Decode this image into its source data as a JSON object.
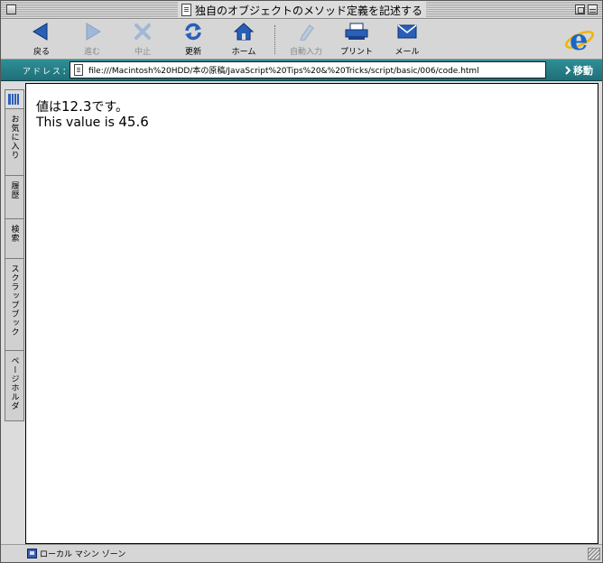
{
  "window": {
    "title": "独自のオブジェクトのメソッド定義を記述する"
  },
  "toolbar": {
    "back_label": "戻る",
    "forward_label": "進む",
    "stop_label": "中止",
    "refresh_label": "更新",
    "home_label": "ホーム",
    "autofill_label": "自動入力",
    "print_label": "プリント",
    "mail_label": "メール"
  },
  "address": {
    "label": "アドレス：",
    "url": "file:///Macintosh%20HDD/本の原稿/JavaScript%20Tips%20&%20Tricks/script/basic/006/code.html",
    "go_label": "移動"
  },
  "sidebar": {
    "tabs": [
      "お気に入り",
      "履歴",
      "検索",
      "スクラップブック",
      "ページホルダ"
    ]
  },
  "content": {
    "line1_prefix": "値は",
    "line1_value": "12.3",
    "line1_suffix": "です。",
    "line2_prefix": "This value is ",
    "line2_value": "45.6"
  },
  "status": {
    "zone": "ローカル マシン ゾーン"
  },
  "colors": {
    "address_bar": "#1f6e78",
    "icon_blue": "#2a5fb8"
  }
}
